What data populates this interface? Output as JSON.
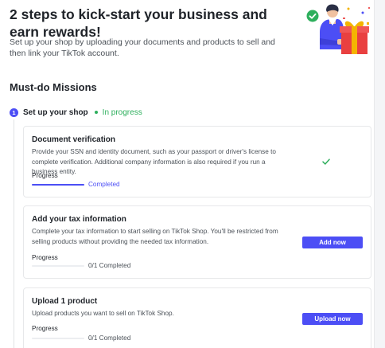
{
  "hero": {
    "title": "2 steps to kick-start your business and earn rewards!",
    "subtitle": "Set up your shop by uploading your documents and products to sell and then link your TikTok account."
  },
  "section": {
    "title": "Must-do Missions"
  },
  "step": {
    "number": "1",
    "label": "Set up your shop",
    "status": "In progress"
  },
  "missions": [
    {
      "title": "Document verification",
      "description": "Provide your SSN and identity document, such as your passport or driver's license to complete verification. Additional company information is also required if you run a business entity.",
      "progress_label": "Progress",
      "progress_text": "Completed",
      "progress": 1.0,
      "check_icon": "check-icon"
    },
    {
      "title": "Add your tax information",
      "description": "Complete your tax information to start selling on TikTok Shop. You'll be restricted from selling products without providing the needed tax information.",
      "progress_label": "Progress",
      "progress_text": "0/1 Completed",
      "progress": 0.0,
      "button": "Add now"
    },
    {
      "title": "Upload 1 product",
      "description": "Upload products you want to sell on TikTok Shop.",
      "progress_label": "Progress",
      "progress_text": "0/1 Completed",
      "progress": 0.0,
      "button": "Upload now"
    }
  ],
  "colors": {
    "accent": "#4c4ef5",
    "success": "#2eaf5d",
    "gift": "#e94040"
  }
}
